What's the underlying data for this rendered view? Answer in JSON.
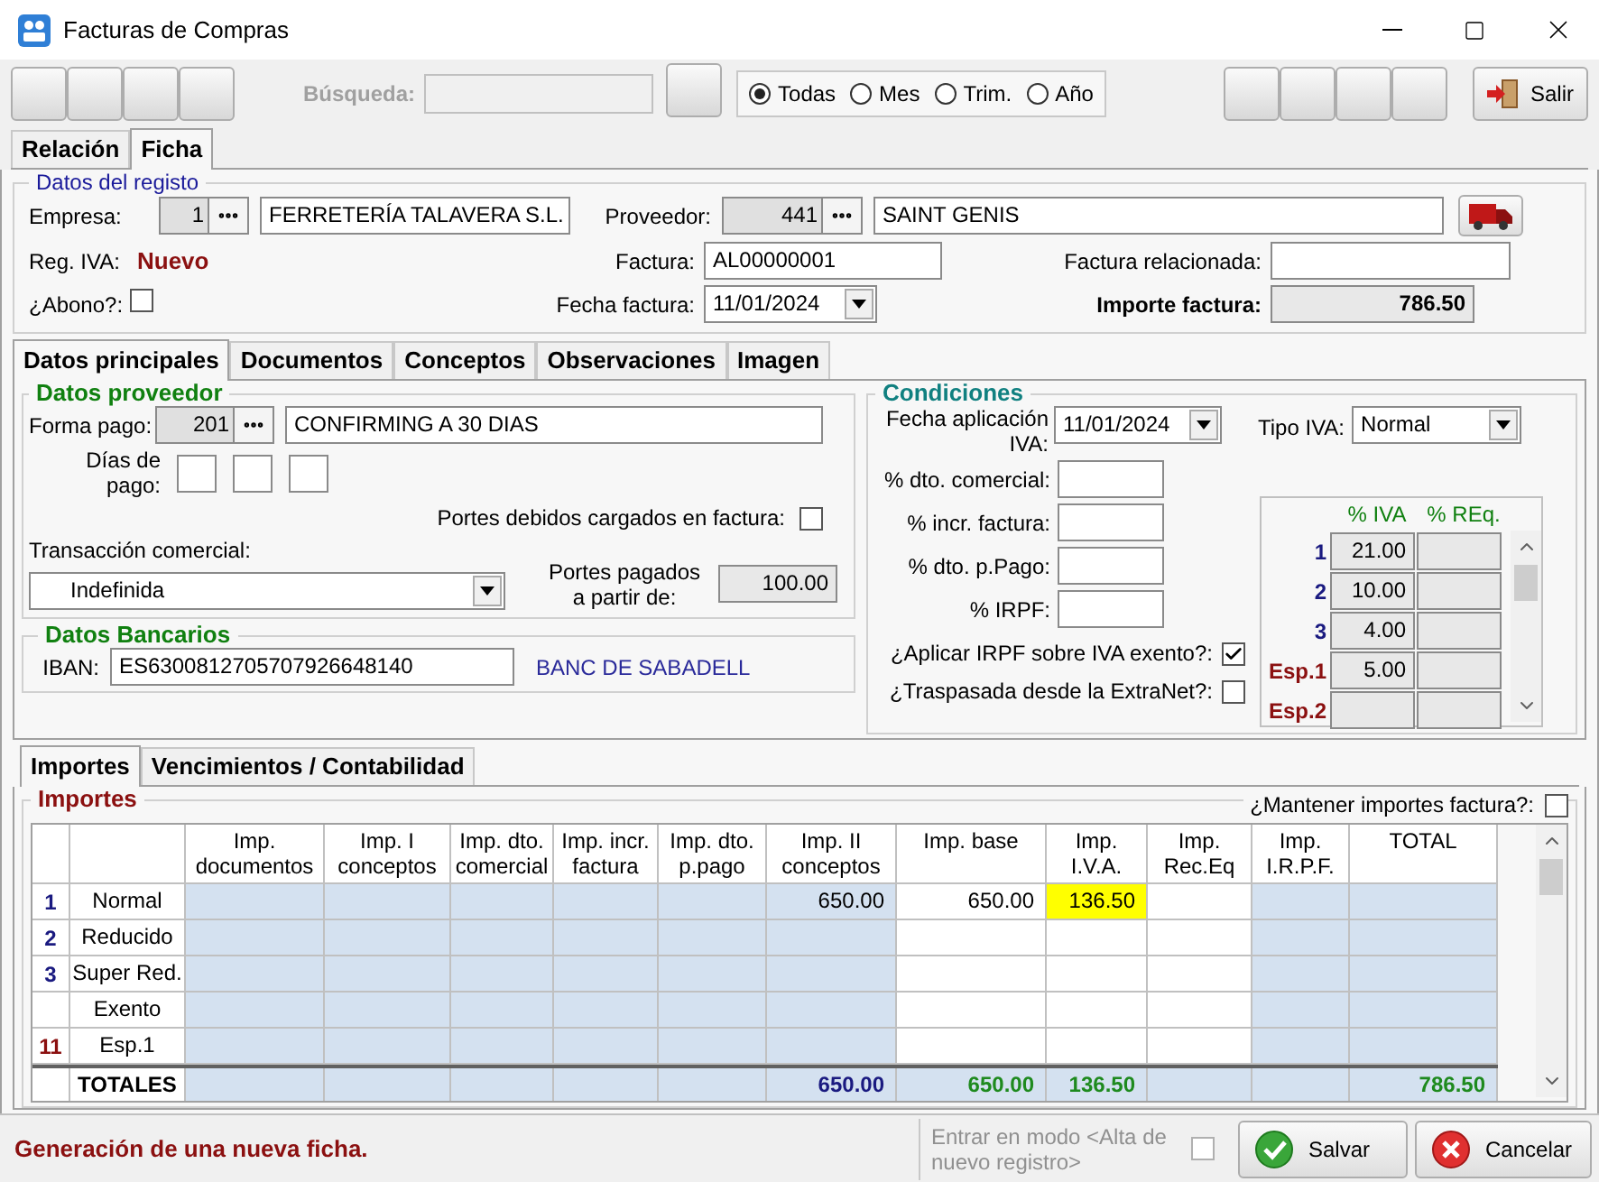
{
  "window": {
    "title": "Facturas de Compras"
  },
  "toolbar": {
    "search": {
      "label": "Búsqueda:",
      "disabled": true
    },
    "filters": [
      {
        "label": "Todas",
        "selected": true
      },
      {
        "label": "Mes",
        "selected": false
      },
      {
        "label": "Trim.",
        "selected": false
      },
      {
        "label": "Año",
        "selected": false
      }
    ],
    "exit_button": "Salir"
  },
  "main_tabs": [
    {
      "label": "Relación",
      "selected": false
    },
    {
      "label": "Ficha",
      "selected": true
    }
  ],
  "registro": {
    "legend": "Datos del registo",
    "empresa": {
      "label": "Empresa:",
      "code": "1",
      "name": "FERRETERÍA TALAVERA S.L."
    },
    "proveedor": {
      "label": "Proveedor:",
      "code": "441",
      "name": "SAINT GENIS"
    },
    "reg_iva": {
      "label": "Reg. IVA:",
      "value": "Nuevo"
    },
    "factura": {
      "label": "Factura:",
      "value": "AL00000001"
    },
    "factura_relacionada": {
      "label": "Factura relacionada:"
    },
    "abono": {
      "label": "¿Abono?:",
      "checked": false
    },
    "fecha_factura": {
      "label": "Fecha factura:",
      "value": "11/01/2024"
    },
    "importe_factura": {
      "label": "Importe factura:",
      "value": "786.50"
    }
  },
  "detail_tabs": [
    {
      "label": "Datos principales",
      "selected": true
    },
    {
      "label": "Documentos",
      "selected": false
    },
    {
      "label": "Conceptos",
      "selected": false
    },
    {
      "label": "Observaciones",
      "selected": false
    },
    {
      "label": "Imagen",
      "selected": false
    }
  ],
  "datos_proveedor": {
    "legend": "Datos proveedor",
    "forma_pago": {
      "label": "Forma pago:",
      "code": "201",
      "name": "CONFIRMING A 30 DIAS"
    },
    "dias_pago": {
      "label": "Días de\npago:"
    },
    "portes_debidos": {
      "label": "Portes debidos cargados en factura:",
      "checked": false
    },
    "transaccion": {
      "label": "Transacción comercial:",
      "value": "Indefinida"
    },
    "portes_pagados": {
      "label": "Portes pagados\na partir de:",
      "value": "100.00"
    }
  },
  "datos_bancarios": {
    "legend": "Datos Bancarios",
    "iban": {
      "label": "IBAN:",
      "value": "ES6300812705707926648140"
    },
    "bank": "BANC DE SABADELL"
  },
  "condiciones": {
    "legend": "Condiciones",
    "fecha_aplicacion": {
      "label": "Fecha aplicación\nIVA:",
      "value": "11/01/2024"
    },
    "tipo_iva": {
      "label": "Tipo IVA:",
      "value": "Normal"
    },
    "percent_fields": [
      {
        "label": "% dto. comercial:"
      },
      {
        "label": "% incr. factura:"
      },
      {
        "label": "% dto. p.Pago:"
      },
      {
        "label": "% IRPF:"
      }
    ],
    "aplicar_irpf": {
      "label": "¿Aplicar IRPF sobre IVA exento?:",
      "checked": true
    },
    "traspasada": {
      "label": "¿Traspasada desde la ExtraNet?:",
      "checked": false
    },
    "iva_table": {
      "columns": [
        "% IVA",
        "% REq."
      ],
      "rows": [
        {
          "label": "1",
          "kind": "general",
          "iva": "21.00"
        },
        {
          "label": "2",
          "kind": "general",
          "iva": "10.00"
        },
        {
          "label": "3",
          "kind": "general",
          "iva": "4.00"
        },
        {
          "label": "Esp.1",
          "kind": "special",
          "iva": "5.00"
        },
        {
          "label": "Esp.2",
          "kind": "special"
        }
      ]
    }
  },
  "importes_tabs": [
    {
      "label": "Importes",
      "selected": true
    },
    {
      "label": "Vencimientos / Contabilidad",
      "selected": false
    }
  ],
  "importes": {
    "legend": "Importes",
    "mantener": {
      "label": "¿Mantener importes factura?:",
      "checked": false
    },
    "columns": [
      {
        "label": "Imp.\ndocumentos",
        "shaded": true
      },
      {
        "label": "Imp. I\nconceptos",
        "shaded": true
      },
      {
        "label": "Imp. dto.\ncomercial",
        "shaded": true
      },
      {
        "label": "Imp. incr.\nfactura",
        "shaded": true
      },
      {
        "label": "Imp. dto.\np.pago",
        "shaded": true
      },
      {
        "label": "Imp. II\nconceptos",
        "shaded": true
      },
      {
        "label": "Imp. base",
        "shaded": false
      },
      {
        "label": "Imp.\nI.V.A.",
        "shaded": false
      },
      {
        "label": "Imp.\nRec.Eq",
        "shaded": false
      },
      {
        "label": "Imp.\nI.R.P.F.",
        "shaded": true
      },
      {
        "label": "TOTAL",
        "shaded": true
      }
    ],
    "rows": [
      {
        "number": "1",
        "kind": "general",
        "label": "Normal",
        "cells": [
          null,
          null,
          null,
          null,
          null,
          {
            "text": "650.00",
            "highlighted": false
          },
          {
            "text": "650.00",
            "highlighted": false
          },
          {
            "text": "136.50",
            "highlighted": true
          },
          null,
          null,
          null
        ]
      },
      {
        "number": "2",
        "kind": "general",
        "label": "Reducido",
        "cells": [
          null,
          null,
          null,
          null,
          null,
          null,
          null,
          null,
          null,
          null,
          null
        ]
      },
      {
        "number": "3",
        "kind": "general",
        "label": "Super Red.",
        "cells": [
          null,
          null,
          null,
          null,
          null,
          null,
          null,
          null,
          null,
          null,
          null
        ]
      },
      {
        "label": "Exento",
        "cells": [
          null,
          null,
          null,
          null,
          null,
          null,
          null,
          null,
          null,
          null,
          null
        ]
      },
      {
        "number": "11",
        "kind": "special",
        "label": "Esp.1",
        "cells": [
          null,
          null,
          null,
          null,
          null,
          null,
          null,
          null,
          null,
          null,
          null
        ]
      }
    ],
    "totals": {
      "label": "TOTALES",
      "cells": [
        null,
        null,
        null,
        null,
        null,
        {
          "text": "650.00",
          "color": "#1a1a80"
        },
        {
          "text": "650.00",
          "color": "#1e8a1e"
        },
        {
          "text": "136.50",
          "color": "#1e8a1e"
        },
        null,
        null,
        {
          "text": "786.50",
          "color": "#1e8a1e"
        }
      ]
    }
  },
  "status": {
    "message": "Generación de una nueva ficha.",
    "modo_alta": {
      "label": "Entrar en modo <Alta de nuevo registro>",
      "checked": false,
      "disabled": true
    },
    "save_button": "Salvar",
    "cancel_button": "Cancelar"
  }
}
